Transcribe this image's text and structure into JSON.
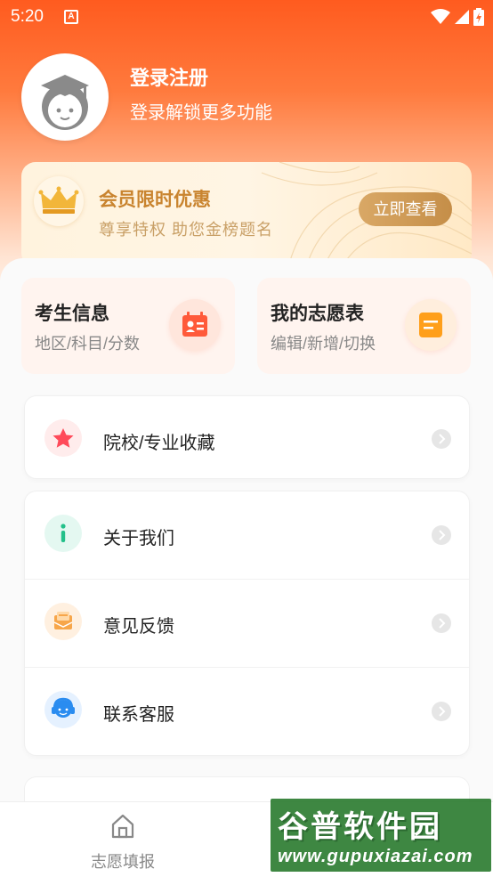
{
  "status_bar": {
    "time": "5:20",
    "notification_icon": "A"
  },
  "profile": {
    "name": "登录注册",
    "subtitle": "登录解锁更多功能"
  },
  "vip": {
    "title": "会员限时优惠",
    "subtitle": "尊享特权  助您金榜题名",
    "button": "立即查看"
  },
  "quick_cards": [
    {
      "title": "考生信息",
      "subtitle": "地区/科目/分数",
      "icon": "id-card-icon"
    },
    {
      "title": "我的志愿表",
      "subtitle": "编辑/新增/切换",
      "icon": "note-icon"
    }
  ],
  "list_groups": [
    {
      "items": [
        {
          "label": "院校/专业收藏",
          "icon": "star-icon"
        }
      ]
    },
    {
      "items": [
        {
          "label": "关于我们",
          "icon": "info-icon"
        },
        {
          "label": "意见反馈",
          "icon": "feedback-icon"
        },
        {
          "label": "联系客服",
          "icon": "headset-icon"
        }
      ]
    }
  ],
  "tab_bar": {
    "items": [
      {
        "label": "志愿填报",
        "icon": "home-icon"
      }
    ]
  },
  "watermark": {
    "title": "谷普软件园",
    "url": "www.gupuxiazai.com"
  },
  "colors": {
    "primary": "#ff5b1f",
    "gold": "#c9842f"
  }
}
